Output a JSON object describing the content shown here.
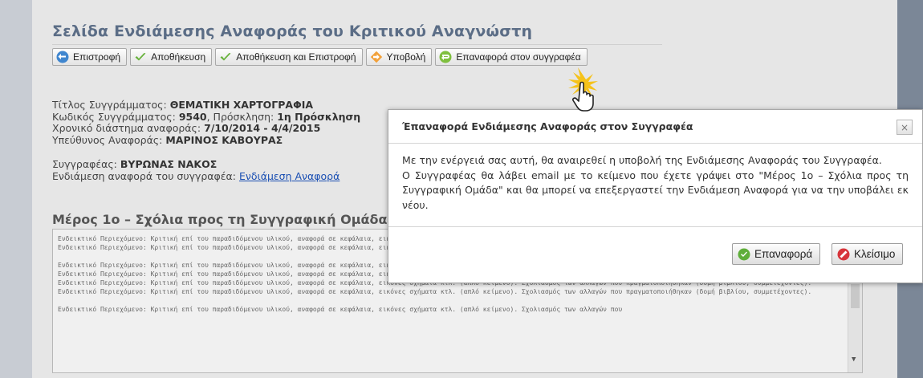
{
  "page": {
    "title": "Σελίδα Ενδιάμεσης Αναφοράς του Κριτικού Αναγνώστη"
  },
  "toolbar": {
    "buttons": [
      {
        "label": "Επιστροφή",
        "icon": "back-arrow-icon"
      },
      {
        "label": "Αποθήκευση",
        "icon": "checkmark-icon"
      },
      {
        "label": "Αποθήκευση και Επιστροφή",
        "icon": "checkmark-icon"
      },
      {
        "label": "Υποβολή",
        "icon": "forward-arrow-icon"
      },
      {
        "label": "Επαναφορά στον συγγραφέα",
        "icon": "return-arrow-icon"
      }
    ]
  },
  "info": {
    "book_title_label": "Τίτλος Συγγράμματος: ",
    "book_title": "ΘΕΜΑΤΙΚΗ ΧΑΡΤΟΓΡΑΦΙΑ",
    "code_label": "Κωδικός Συγγράμματος: ",
    "code": "9540",
    "call_label": ", Πρόσκληση: ",
    "call": "1η Πρόσκληση",
    "period_label": "Χρονικό διάστημα αναφοράς: ",
    "period": "7/10/2014 - 4/4/2015",
    "responsible_label": "Υπεύθυνος Αναφοράς: ",
    "responsible": "ΜΑΡΙΝΟΣ ΚΑΒΟΥΡΑΣ",
    "author_label": "Συγγραφέας: ",
    "author": "ΒΥΡΩΝΑΣ ΝΑΚΟΣ",
    "report_label": "Ενδιάμεση αναφορά του συγγραφέα: ",
    "report_link": "Ενδιάμεση Αναφορά"
  },
  "section": {
    "title": "Μέρος 1ο – Σχόλια προς τη Συγγραφική Ομάδα ["
  },
  "editor": {
    "paragraphs": [
      "Ενδεικτικό Περιεχόμενο: Κριτική επί του παραδιδόμενου υλικού, αναφορά σε κεφάλαια, εικόνες σχήματα κτλ. (απλό κείμενο). Σχολιασμός των αλλαγών που πραγματοποιήθηκαν (δομή βιβλίου, συμμετέχοντες). Ενδεικτικό Περιεχόμενο: Κριτική επί του παραδιδόμενου υλικού, αναφορά σε κεφάλαια, εικόνες σχήματα κτλ. (απλό κείμενο). Σχολιασμός των αλλαγών που πραγματοποιήθηκαν (δομή βιβλίου, συμμετέχοντες).",
      "Ενδεικτικό Περιεχόμενο: Κριτική επί του παραδιδόμενου υλικού, αναφορά σε κεφάλαια, εικόνες σχήματα κτλ. (απλό κείμενο). Σχολιασμός των αλλαγών που πραγματοποιήθηκαν (δομή βιβλίου, συμμετέχοντες). Ενδεικτικό Περιεχόμενο: Κριτική επί του παραδιδόμενου υλικού, αναφορά σε κεφάλαια, εικόνες σχήματα κτλ. (απλό κείμενο). Σχολιασμός των αλλαγών που πραγματοποιήθηκαν (δομή βιβλίου, συμμετέχοντες). Ενδεικτικό Περιεχόμενο: Κριτική επί του παραδιδόμενου υλικού, αναφορά σε κεφάλαια, εικόνες σχήματα κτλ. (απλό κείμενο). Σχολιασμός των αλλαγών που πραγματοποιήθηκαν (δομή βιβλίου, συμμετέχοντες). Ενδεικτικό Περιεχόμενο: Κριτική επί του παραδιδόμενου υλικού, αναφορά σε κεφάλαια, εικόνες σχήματα κτλ. (απλό κείμενο). Σχολιασμός των αλλαγών που πραγματοποιήθηκαν (δομή βιβλίου, συμμετέχοντες).",
      "Ενδεικτικό Περιεχόμενο: Κριτική επί του παραδιδόμενου υλικού, αναφορά σε κεφάλαια, εικόνες σχήματα κτλ. (απλό κείμενο). Σχολιασμός των αλλαγών που"
    ]
  },
  "dialog": {
    "title": "Έπαναφορά Ενδιάμεσης Αναφοράς στον Συγγραφέα",
    "close_label": "×",
    "paragraph1": "Με την ενέργειά σας αυτή, θα αναιρεθεί η υποβολή της Ενδιάμεσης Αναφοράς του Συγγραφέα.",
    "paragraph2": "Ο Συγγραφέας θα λάβει email με το κείμενο που έχετε γράψει στο \"Μέρος 1ο – Σχόλια προς τη Συγγραφική Ομάδα\" και θα μπορεί να επεξεργαστεί την Ενδιάμεση Αναφορά για να την υποβάλει εκ νέου.",
    "restore_label": "Επαναφορά",
    "close_button_label": "Κλείσιμο"
  },
  "colors": {
    "title": "#5b6d86",
    "link": "#1a4fb3",
    "backdrop": "#7b8797"
  }
}
